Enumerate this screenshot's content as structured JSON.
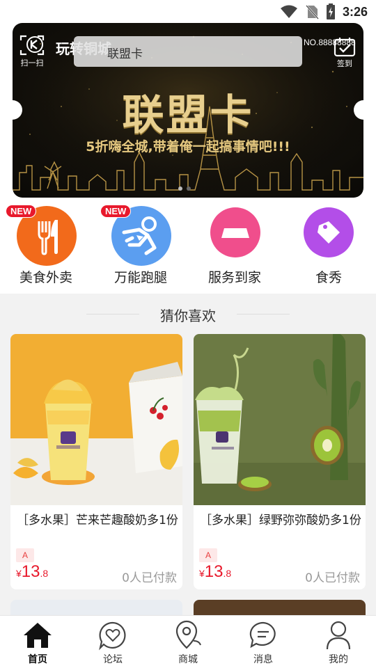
{
  "status_bar": {
    "time": "3:26"
  },
  "header": {
    "scan_label": "扫一扫",
    "app_name": "玩转铜城",
    "search_placeholder": "联盟卡",
    "signin_label": "签到"
  },
  "banner": {
    "title": "联盟卡",
    "subtitle": "5折嗨全城,带着俺一起搞事情吧!!!",
    "card_no": "NO.88888888",
    "slide_count": 2,
    "active_slide": 1
  },
  "categories": [
    {
      "label": "美食外卖",
      "badge": "NEW",
      "color": "#f26a1b",
      "icon": "fork-knife-icon"
    },
    {
      "label": "万能跑腿",
      "badge": "NEW",
      "color": "#5b9ef0",
      "icon": "runner-icon"
    },
    {
      "label": "服务到家",
      "badge": "",
      "color": "#f04e8c",
      "icon": "home-service-icon"
    },
    {
      "label": "食秀",
      "badge": "",
      "color": "#b34ee8",
      "icon": "tag-icon"
    }
  ],
  "section": {
    "title": "猜你喜欢"
  },
  "products": [
    {
      "name": "［多水果］芒来芒趣酸奶多1份",
      "tag": "A",
      "currency": "¥",
      "price_int": "13",
      "price_dec": ".8",
      "sold": "0人已付款"
    },
    {
      "name": "［多水果］绿野弥弥酸奶多1份",
      "tag": "A",
      "currency": "¥",
      "price_int": "13",
      "price_dec": ".8",
      "sold": "0人已付款"
    }
  ],
  "bottom_nav": [
    {
      "label": "首页",
      "icon": "home-icon",
      "active": true
    },
    {
      "label": "论坛",
      "icon": "forum-heart-icon",
      "active": false
    },
    {
      "label": "商城",
      "icon": "map-pin-icon",
      "active": false
    },
    {
      "label": "消息",
      "icon": "message-icon",
      "active": false
    },
    {
      "label": "我的",
      "icon": "profile-icon",
      "active": false
    }
  ],
  "colors": {
    "accent_red": "#e8192c",
    "gold": "#e8cf8e"
  }
}
